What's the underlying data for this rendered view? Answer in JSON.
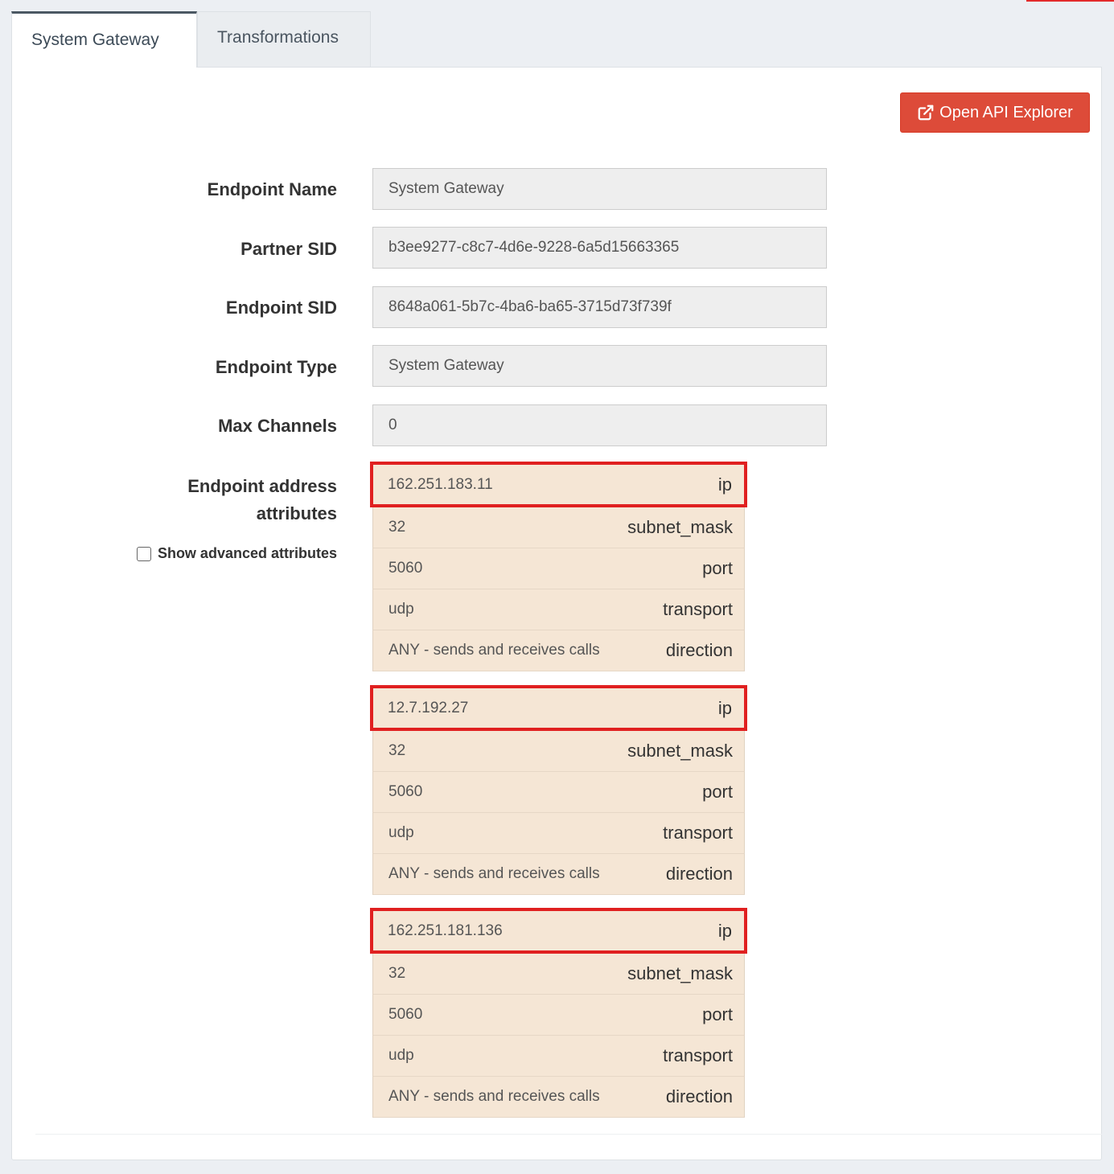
{
  "tabs": [
    {
      "label": "System Gateway",
      "active": true
    },
    {
      "label": "Transformations",
      "active": false
    }
  ],
  "toolbar": {
    "api_button_label": "Open API Explorer"
  },
  "fields": {
    "endpoint_name": {
      "label": "Endpoint Name",
      "value": "System Gateway"
    },
    "partner_sid": {
      "label": "Partner SID",
      "value": "b3ee9277-c8c7-4d6e-9228-6a5d15663365"
    },
    "endpoint_sid": {
      "label": "Endpoint SID",
      "value": "8648a061-5b7c-4ba6-ba65-3715d73f739f"
    },
    "endpoint_type": {
      "label": "Endpoint Type",
      "value": "System Gateway"
    },
    "max_channels": {
      "label": "Max Channels",
      "value": "0"
    }
  },
  "address": {
    "label_line1": "Endpoint address",
    "label_line2": "attributes",
    "advanced_label": "Show advanced attributes",
    "advanced_checked": false,
    "groups": [
      {
        "ip": "162.251.183.11",
        "subnet_mask": "32",
        "port": "5060",
        "transport": "udp",
        "direction": "ANY - sends and receives calls"
      },
      {
        "ip": "12.7.192.27",
        "subnet_mask": "32",
        "port": "5060",
        "transport": "udp",
        "direction": "ANY - sends and receives calls"
      },
      {
        "ip": "162.251.181.136",
        "subnet_mask": "32",
        "port": "5060",
        "transport": "udp",
        "direction": "ANY - sends and receives calls"
      }
    ],
    "keys": {
      "ip": "ip",
      "subnet_mask": "subnet_mask",
      "port": "port",
      "transport": "transport",
      "direction": "direction"
    }
  },
  "colors": {
    "accent_button": "#dd4b39",
    "highlight_border": "#e02020",
    "attr_row_bg": "#f5e6d5"
  }
}
